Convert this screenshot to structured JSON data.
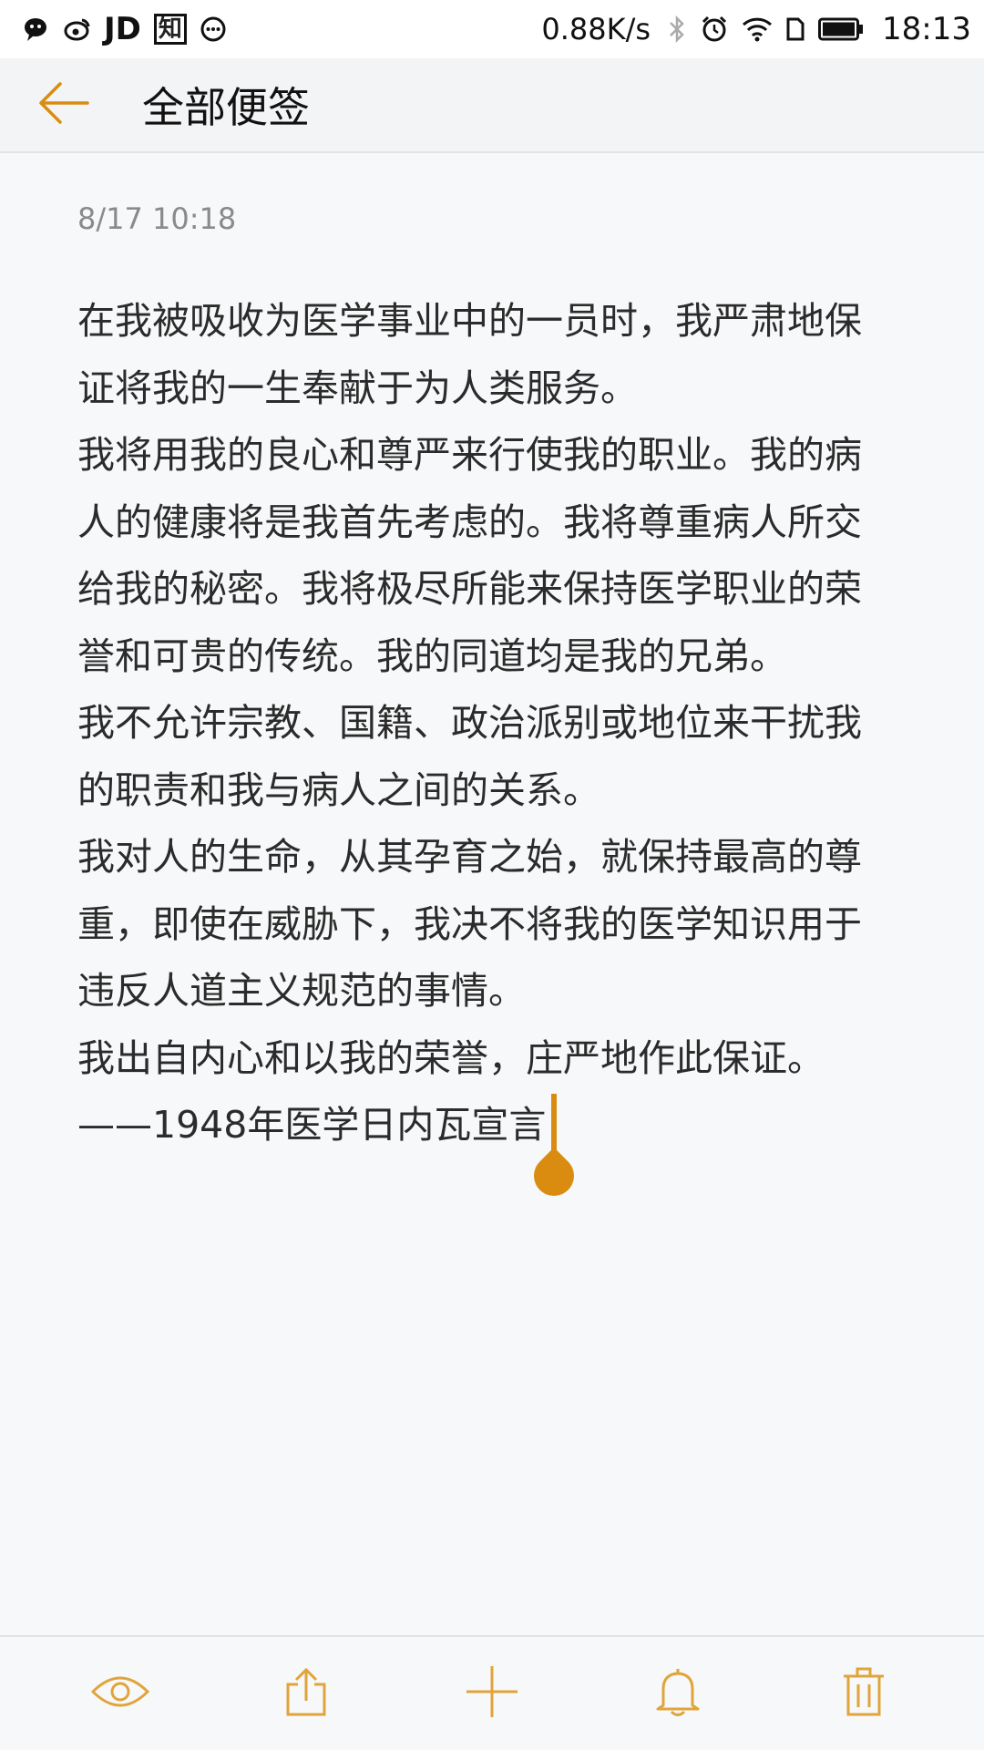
{
  "status_bar": {
    "app_icons": [
      "wechat-icon",
      "weibo-icon",
      "jd-icon",
      "zhihu-icon",
      "message-icon"
    ],
    "jd_label": "JD",
    "zhihu_label": "知",
    "network_speed": "0.88K/s",
    "time": "18:13"
  },
  "header": {
    "title": "全部便签",
    "accent_color": "#d98c10"
  },
  "note": {
    "date": "8/17 10:18",
    "paragraphs": [
      "在我被吸收为医学事业中的一员时，我严肃地保证将我的一生奉献于为人类服务。",
      "我将用我的良心和尊严来行使我的职业。我的病人的健康将是我首先考虑的。我将尊重病人所交给我的秘密。我将极尽所能来保持医学职业的荣誉和可贵的传统。我的同道均是我的兄弟。",
      "我不允许宗教、国籍、政治派别或地位来干扰我的职责和我与病人之间的关系。",
      "我对人的生命，从其孕育之始，就保持最高的尊重，即使在威胁下，我决不将我的医学知识用于违反人道主义规范的事情。",
      "我出自内心和以我的荣誉，庄严地作此保证。",
      "——1948年医学日内瓦宣言"
    ]
  },
  "toolbar": {
    "items": [
      "eye-icon",
      "share-icon",
      "add-icon",
      "bell-icon",
      "trash-icon"
    ]
  }
}
